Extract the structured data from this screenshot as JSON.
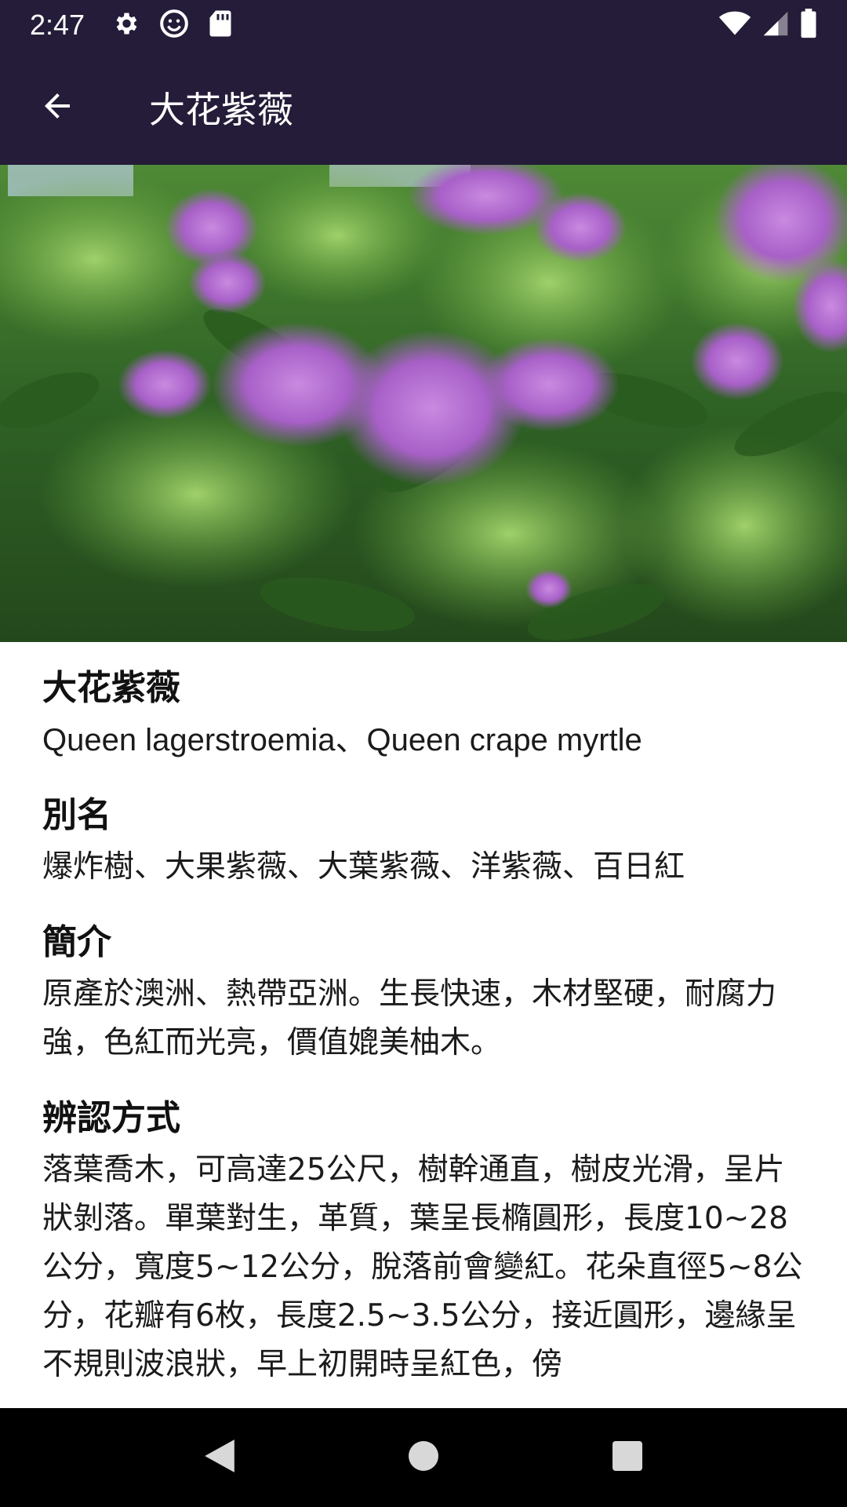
{
  "status_bar": {
    "time": "2:47",
    "icons_left": [
      "settings-icon",
      "smiley-icon",
      "sd-card-icon"
    ],
    "icons_right": [
      "wifi-icon",
      "signal-icon",
      "battery-icon"
    ]
  },
  "app_bar": {
    "back_icon": "arrow-left-icon",
    "title": "大花紫薇"
  },
  "hero": {
    "description_icon": "flower-photo"
  },
  "sections": [
    {
      "heading": "大花紫薇",
      "body": "Queen lagerstroemia、Queen crape myrtle"
    },
    {
      "heading": "別名",
      "body": "爆炸樹、大果紫薇、大葉紫薇、洋紫薇、百日紅"
    },
    {
      "heading": "簡介",
      "body": "原產於澳洲、熱帶亞洲。生長快速，木材堅硬，耐腐力強，色紅而光亮，價值媲美柚木。"
    },
    {
      "heading": "辨認方式",
      "body": "落葉喬木，可高達25公尺，樹幹通直，樹皮光滑，呈片狀剝落。單葉對生，革質，葉呈長橢圓形，長度10~28公分，寬度5~12公分，脫落前會變紅。花朵直徑5~8公分，花瓣有6枚，長度2.5~3.5公分，接近圓形，邊緣呈不規則波浪狀，早上初開時呈紅色，傍"
    }
  ],
  "nav_bar": {
    "icons": [
      "back-triangle-icon",
      "home-circle-icon",
      "recents-square-icon"
    ]
  },
  "colors": {
    "bar_background": "#241c38",
    "nav_background": "#000000"
  }
}
